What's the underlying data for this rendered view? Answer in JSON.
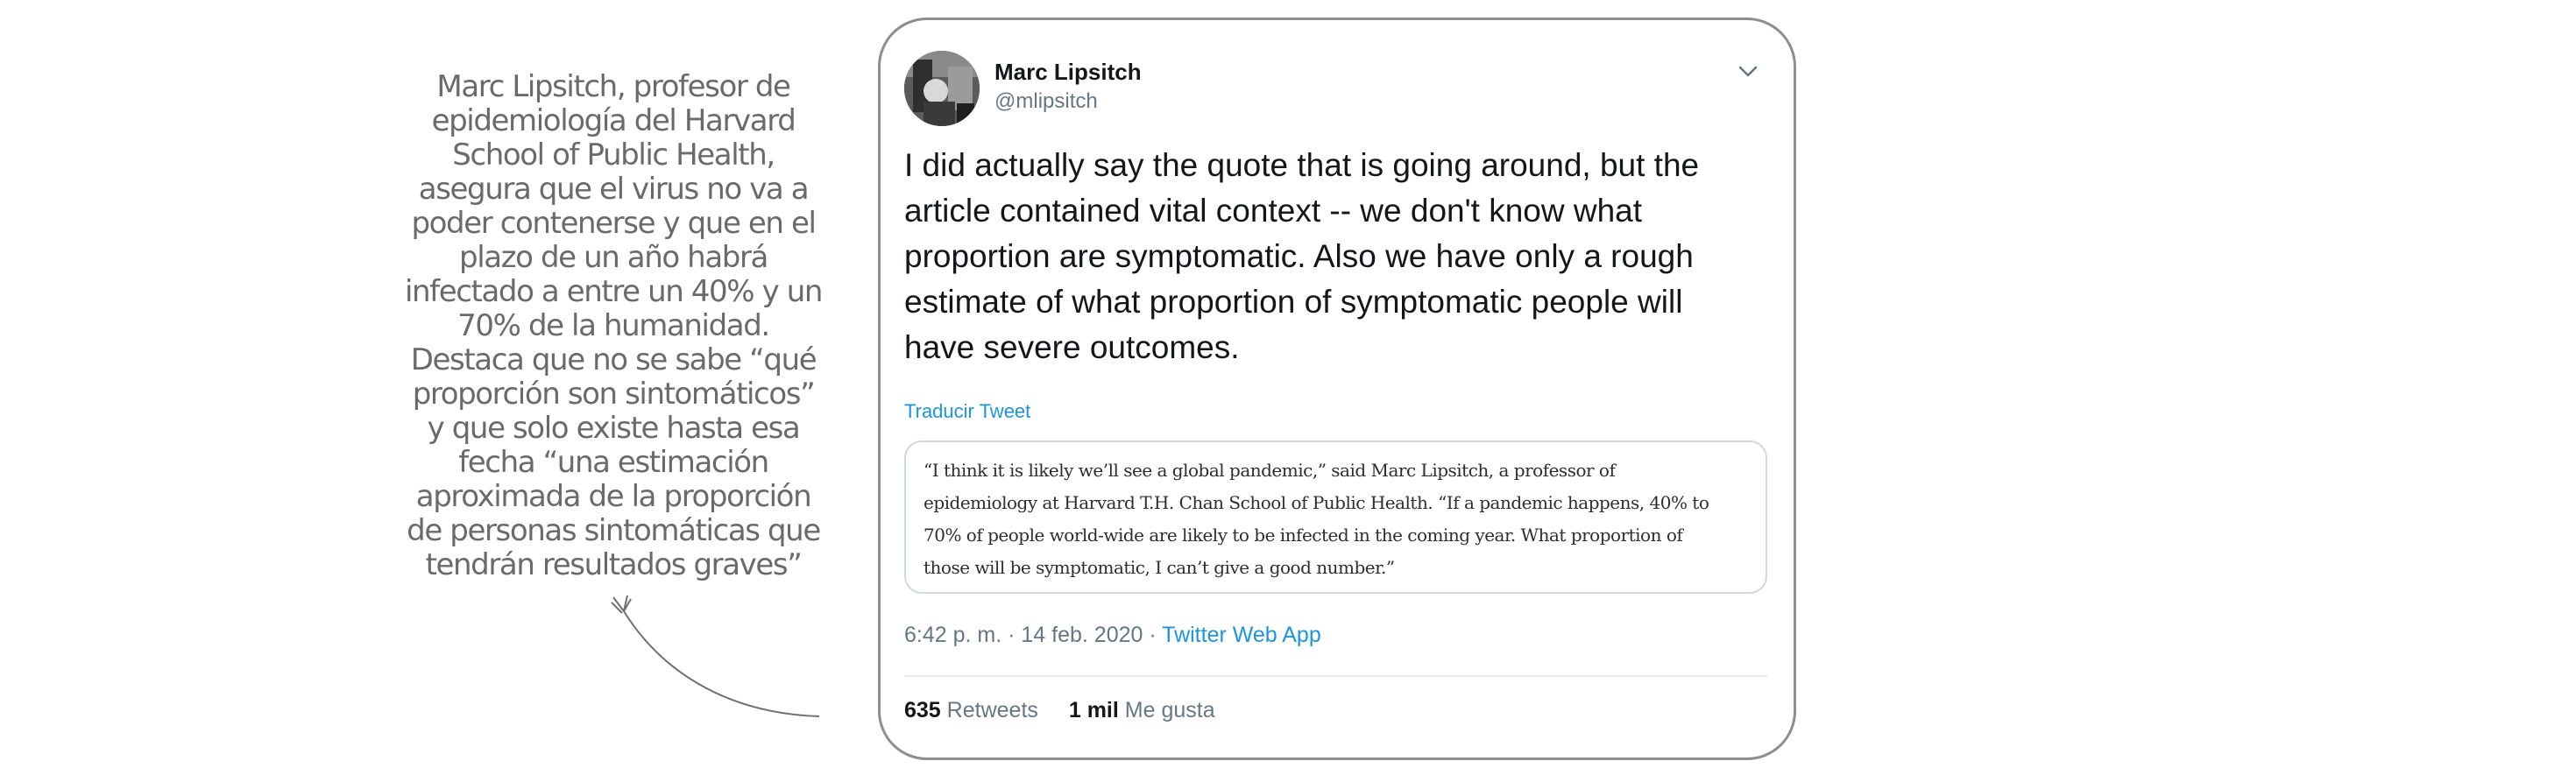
{
  "annotation": {
    "lines": [
      "Marc Lipsitch, profesor de",
      "epidemiología del Harvard",
      "School of Public Health,",
      "asegura que el virus no va a",
      "poder contenerse y que en el",
      "plazo de un año habrá",
      "infectado a entre un 40% y un",
      "70% de la humanidad.",
      "Destaca que no se sabe “qué",
      "proporción son sintomáticos”",
      "y que solo existe hasta esa",
      "fecha “una estimación",
      "aproximada de la proporción",
      "de personas sintomáticas que",
      "tendrán resultados graves”"
    ]
  },
  "tweet": {
    "author_name": "Marc Lipsitch",
    "author_handle": "@mlipsitch",
    "text_lines": [
      "I did actually say the quote that is going around, but the",
      "article contained vital context -- we don't know what",
      "proportion are symptomatic. Also we have only a rough",
      "estimate of what proportion of symptomatic people will",
      "have severe outcomes."
    ],
    "translate_label": "Traducir Tweet",
    "quote_lines": [
      "“I think it is likely we’ll see a global pandemic,” said Marc Lipsitch, a professor of",
      "epidemiology at Harvard T.H. Chan School of Public Health. “If a pandemic happens, 40% to",
      "70% of people world-wide are likely to be infected in the coming year. What proportion of",
      "those will be symptomatic, I can’t give a good number.”"
    ],
    "timestamp": "6:42 p. m. · 14 feb. 2020 · ",
    "source_app": "Twitter Web App",
    "retweets_count": "635",
    "retweets_label": "Retweets",
    "likes_count": "1 mil",
    "likes_label": "Me gusta"
  },
  "icons": {
    "avatar": "avatar-photo",
    "menu": "chevron-down-icon",
    "arrow": "curved-arrow-icon"
  },
  "colors": {
    "link": "#1b95e0",
    "secondary_text": "#657786",
    "primary_text": "#14171a",
    "annotation_text": "#6a6a6a",
    "card_border": "#8e8e8e"
  }
}
